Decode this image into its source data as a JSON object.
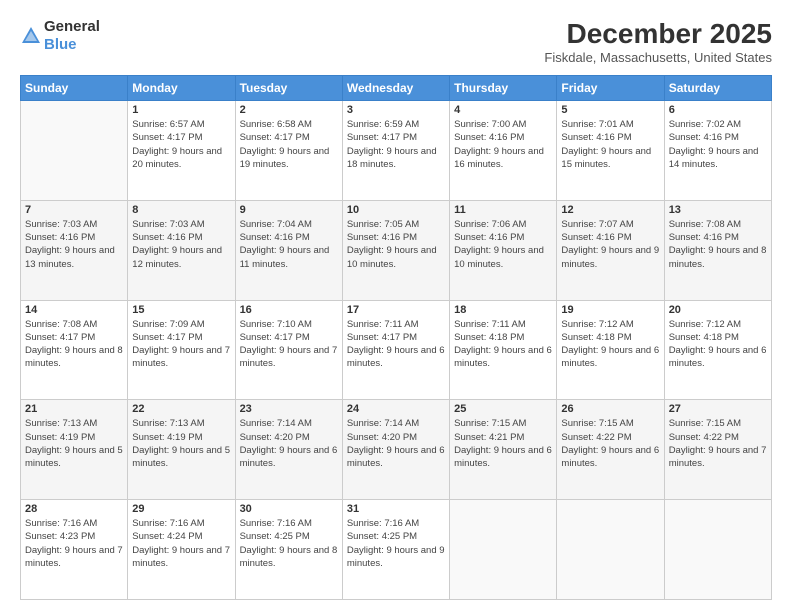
{
  "logo": {
    "general": "General",
    "blue": "Blue"
  },
  "header": {
    "month": "December 2025",
    "location": "Fiskdale, Massachusetts, United States"
  },
  "weekdays": [
    "Sunday",
    "Monday",
    "Tuesday",
    "Wednesday",
    "Thursday",
    "Friday",
    "Saturday"
  ],
  "weeks": [
    [
      {
        "day": "",
        "sunrise": "",
        "sunset": "",
        "daylight": ""
      },
      {
        "day": "1",
        "sunrise": "Sunrise: 6:57 AM",
        "sunset": "Sunset: 4:17 PM",
        "daylight": "Daylight: 9 hours and 20 minutes."
      },
      {
        "day": "2",
        "sunrise": "Sunrise: 6:58 AM",
        "sunset": "Sunset: 4:17 PM",
        "daylight": "Daylight: 9 hours and 19 minutes."
      },
      {
        "day": "3",
        "sunrise": "Sunrise: 6:59 AM",
        "sunset": "Sunset: 4:17 PM",
        "daylight": "Daylight: 9 hours and 18 minutes."
      },
      {
        "day": "4",
        "sunrise": "Sunrise: 7:00 AM",
        "sunset": "Sunset: 4:16 PM",
        "daylight": "Daylight: 9 hours and 16 minutes."
      },
      {
        "day": "5",
        "sunrise": "Sunrise: 7:01 AM",
        "sunset": "Sunset: 4:16 PM",
        "daylight": "Daylight: 9 hours and 15 minutes."
      },
      {
        "day": "6",
        "sunrise": "Sunrise: 7:02 AM",
        "sunset": "Sunset: 4:16 PM",
        "daylight": "Daylight: 9 hours and 14 minutes."
      }
    ],
    [
      {
        "day": "7",
        "sunrise": "Sunrise: 7:03 AM",
        "sunset": "Sunset: 4:16 PM",
        "daylight": "Daylight: 9 hours and 13 minutes."
      },
      {
        "day": "8",
        "sunrise": "Sunrise: 7:03 AM",
        "sunset": "Sunset: 4:16 PM",
        "daylight": "Daylight: 9 hours and 12 minutes."
      },
      {
        "day": "9",
        "sunrise": "Sunrise: 7:04 AM",
        "sunset": "Sunset: 4:16 PM",
        "daylight": "Daylight: 9 hours and 11 minutes."
      },
      {
        "day": "10",
        "sunrise": "Sunrise: 7:05 AM",
        "sunset": "Sunset: 4:16 PM",
        "daylight": "Daylight: 9 hours and 10 minutes."
      },
      {
        "day": "11",
        "sunrise": "Sunrise: 7:06 AM",
        "sunset": "Sunset: 4:16 PM",
        "daylight": "Daylight: 9 hours and 10 minutes."
      },
      {
        "day": "12",
        "sunrise": "Sunrise: 7:07 AM",
        "sunset": "Sunset: 4:16 PM",
        "daylight": "Daylight: 9 hours and 9 minutes."
      },
      {
        "day": "13",
        "sunrise": "Sunrise: 7:08 AM",
        "sunset": "Sunset: 4:16 PM",
        "daylight": "Daylight: 9 hours and 8 minutes."
      }
    ],
    [
      {
        "day": "14",
        "sunrise": "Sunrise: 7:08 AM",
        "sunset": "Sunset: 4:17 PM",
        "daylight": "Daylight: 9 hours and 8 minutes."
      },
      {
        "day": "15",
        "sunrise": "Sunrise: 7:09 AM",
        "sunset": "Sunset: 4:17 PM",
        "daylight": "Daylight: 9 hours and 7 minutes."
      },
      {
        "day": "16",
        "sunrise": "Sunrise: 7:10 AM",
        "sunset": "Sunset: 4:17 PM",
        "daylight": "Daylight: 9 hours and 7 minutes."
      },
      {
        "day": "17",
        "sunrise": "Sunrise: 7:11 AM",
        "sunset": "Sunset: 4:17 PM",
        "daylight": "Daylight: 9 hours and 6 minutes."
      },
      {
        "day": "18",
        "sunrise": "Sunrise: 7:11 AM",
        "sunset": "Sunset: 4:18 PM",
        "daylight": "Daylight: 9 hours and 6 minutes."
      },
      {
        "day": "19",
        "sunrise": "Sunrise: 7:12 AM",
        "sunset": "Sunset: 4:18 PM",
        "daylight": "Daylight: 9 hours and 6 minutes."
      },
      {
        "day": "20",
        "sunrise": "Sunrise: 7:12 AM",
        "sunset": "Sunset: 4:18 PM",
        "daylight": "Daylight: 9 hours and 6 minutes."
      }
    ],
    [
      {
        "day": "21",
        "sunrise": "Sunrise: 7:13 AM",
        "sunset": "Sunset: 4:19 PM",
        "daylight": "Daylight: 9 hours and 5 minutes."
      },
      {
        "day": "22",
        "sunrise": "Sunrise: 7:13 AM",
        "sunset": "Sunset: 4:19 PM",
        "daylight": "Daylight: 9 hours and 5 minutes."
      },
      {
        "day": "23",
        "sunrise": "Sunrise: 7:14 AM",
        "sunset": "Sunset: 4:20 PM",
        "daylight": "Daylight: 9 hours and 6 minutes."
      },
      {
        "day": "24",
        "sunrise": "Sunrise: 7:14 AM",
        "sunset": "Sunset: 4:20 PM",
        "daylight": "Daylight: 9 hours and 6 minutes."
      },
      {
        "day": "25",
        "sunrise": "Sunrise: 7:15 AM",
        "sunset": "Sunset: 4:21 PM",
        "daylight": "Daylight: 9 hours and 6 minutes."
      },
      {
        "day": "26",
        "sunrise": "Sunrise: 7:15 AM",
        "sunset": "Sunset: 4:22 PM",
        "daylight": "Daylight: 9 hours and 6 minutes."
      },
      {
        "day": "27",
        "sunrise": "Sunrise: 7:15 AM",
        "sunset": "Sunset: 4:22 PM",
        "daylight": "Daylight: 9 hours and 7 minutes."
      }
    ],
    [
      {
        "day": "28",
        "sunrise": "Sunrise: 7:16 AM",
        "sunset": "Sunset: 4:23 PM",
        "daylight": "Daylight: 9 hours and 7 minutes."
      },
      {
        "day": "29",
        "sunrise": "Sunrise: 7:16 AM",
        "sunset": "Sunset: 4:24 PM",
        "daylight": "Daylight: 9 hours and 7 minutes."
      },
      {
        "day": "30",
        "sunrise": "Sunrise: 7:16 AM",
        "sunset": "Sunset: 4:25 PM",
        "daylight": "Daylight: 9 hours and 8 minutes."
      },
      {
        "day": "31",
        "sunrise": "Sunrise: 7:16 AM",
        "sunset": "Sunset: 4:25 PM",
        "daylight": "Daylight: 9 hours and 9 minutes."
      },
      {
        "day": "",
        "sunrise": "",
        "sunset": "",
        "daylight": ""
      },
      {
        "day": "",
        "sunrise": "",
        "sunset": "",
        "daylight": ""
      },
      {
        "day": "",
        "sunrise": "",
        "sunset": "",
        "daylight": ""
      }
    ]
  ]
}
